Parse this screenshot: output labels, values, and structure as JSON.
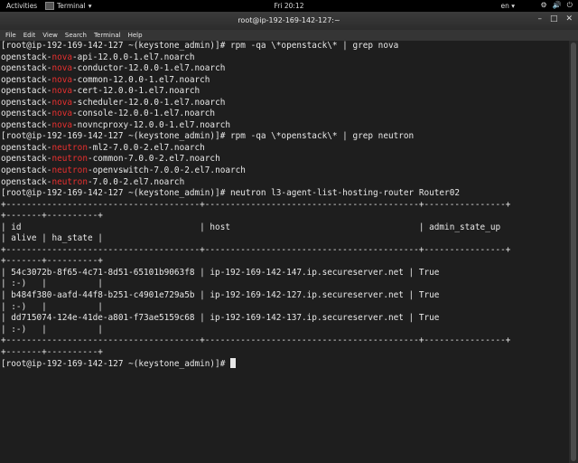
{
  "topbar": {
    "activities": "Activities",
    "app_name": "Terminal",
    "app_caret": "▾",
    "clock": "Fri 20:12",
    "lang": "en",
    "lang_caret": "▾",
    "tray": [
      "⚙",
      "🔊",
      "⏻"
    ]
  },
  "window": {
    "title": "root@ip-192-169-142-127:~",
    "menu": [
      "File",
      "Edit",
      "View",
      "Search",
      "Terminal",
      "Help"
    ],
    "controls": [
      "–",
      "□",
      "✕"
    ]
  },
  "terminal": {
    "lines": [
      [
        "[root@ip-192-169-142-127 ~(keystone_admin)]# rpm -qa \\*openstack\\* | grep nova"
      ],
      [
        "openstack-",
        {
          "h": "nova"
        },
        "-api-12.0.0-1.el7.noarch"
      ],
      [
        "openstack-",
        {
          "h": "nova"
        },
        "-conductor-12.0.0-1.el7.noarch"
      ],
      [
        "openstack-",
        {
          "h": "nova"
        },
        "-common-12.0.0-1.el7.noarch"
      ],
      [
        "openstack-",
        {
          "h": "nova"
        },
        "-cert-12.0.0-1.el7.noarch"
      ],
      [
        "openstack-",
        {
          "h": "nova"
        },
        "-scheduler-12.0.0-1.el7.noarch"
      ],
      [
        "openstack-",
        {
          "h": "nova"
        },
        "-console-12.0.0-1.el7.noarch"
      ],
      [
        "openstack-",
        {
          "h": "nova"
        },
        "-novncproxy-12.0.0-1.el7.noarch"
      ],
      [
        "[root@ip-192-169-142-127 ~(keystone_admin)]# rpm -qa \\*openstack\\* | grep neutron"
      ],
      [
        "openstack-",
        {
          "h": "neutron"
        },
        "-ml2-7.0.0-2.el7.noarch"
      ],
      [
        "openstack-",
        {
          "h": "neutron"
        },
        "-common-7.0.0-2.el7.noarch"
      ],
      [
        "openstack-",
        {
          "h": "neutron"
        },
        "-openvswitch-7.0.0-2.el7.noarch"
      ],
      [
        "openstack-",
        {
          "h": "neutron"
        },
        "-7.0.0-2.el7.noarch"
      ],
      [
        "[root@ip-192-169-142-127 ~(keystone_admin)]# neutron l3-agent-list-hosting-router Router02"
      ],
      [
        "+--------------------------------------+------------------------------------------+----------------+"
      ],
      [
        "+-------+----------+"
      ],
      [
        "| id                                   | host                                     | admin_state_up"
      ],
      [
        "| alive | ha_state |"
      ],
      [
        "+--------------------------------------+------------------------------------------+----------------+"
      ],
      [
        "+-------+----------+"
      ],
      [
        "| 54c3072b-8f65-4c71-8d51-65101b9063f8 | ip-192-169-142-147.ip.secureserver.net | True"
      ],
      [
        "| :-)   |          |"
      ],
      [
        "| b484f380-aafd-44f8-b251-c4901e729a5b | ip-192-169-142-127.ip.secureserver.net | True"
      ],
      [
        "| :-)   |          |"
      ],
      [
        "| dd715074-124e-41de-a801-f73ae5159c68 | ip-192-169-142-137.ip.secureserver.net | True"
      ],
      [
        "| :-)   |          |"
      ],
      [
        "+--------------------------------------+------------------------------------------+----------------+"
      ],
      [
        "+-------+----------+"
      ],
      [
        "[root@ip-192-169-142-127 ~(keystone_admin)]# ",
        {
          "cursor": true
        }
      ]
    ]
  },
  "colors": {
    "terminal_bg": "#1e1e1e",
    "terminal_fg": "#e8e8e8",
    "grep_highlight": "#e8302f"
  }
}
